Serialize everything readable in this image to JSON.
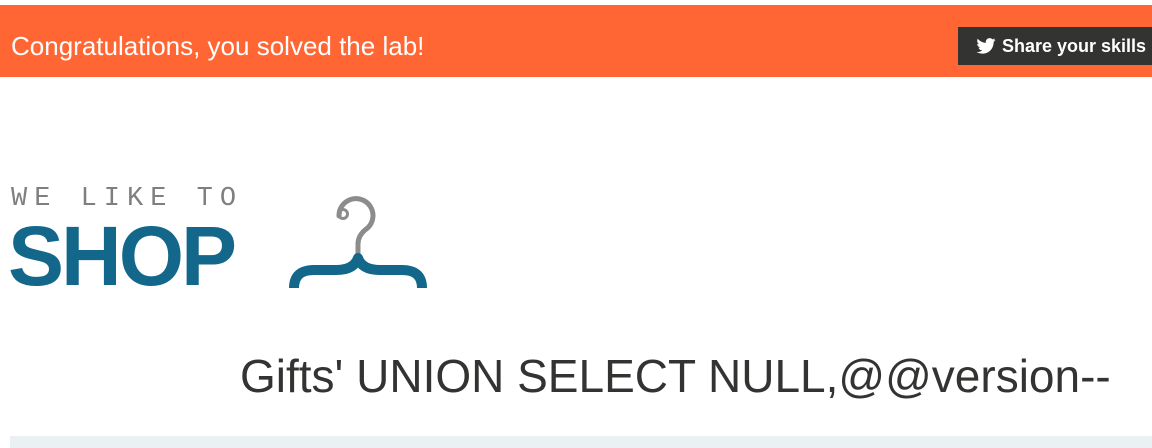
{
  "banner": {
    "message": "Congratulations, you solved the lab!",
    "share_label": "Share your skills",
    "share_icon": "twitter-icon",
    "background_color": "#ff6633"
  },
  "logo": {
    "tagline": "WE LIKE TO",
    "brand": "SHOP",
    "icon": "hanger-icon",
    "brand_color": "#13678a"
  },
  "main": {
    "title": "Gifts' UNION SELECT NULL,@@version--"
  }
}
